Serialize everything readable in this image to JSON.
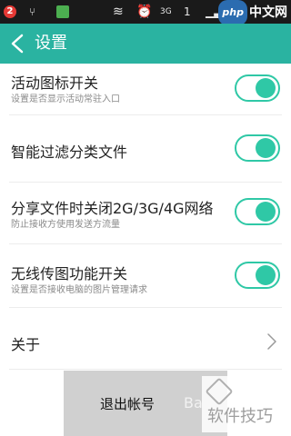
{
  "status_bar": {
    "notification_count": "2",
    "usb_icon": "usb-icon",
    "wifi_icon": "wifi-icon",
    "alarm_icon": "alarm-icon",
    "network_type": "3G",
    "sim_label": "1",
    "watermark": "php中文网"
  },
  "header": {
    "title": "设置",
    "back_icon": "chevron-left-icon",
    "background": "#2ab3a1"
  },
  "settings": [
    {
      "title": "活动图标开关",
      "subtitle": "设置是否显示活动常驻入口",
      "toggle_on": true
    },
    {
      "title": "智能过滤分类文件",
      "subtitle": "",
      "toggle_on": true
    },
    {
      "title": "分享文件时关闭2G/3G/4G网络",
      "subtitle": "防止接收方使用发送方流量",
      "toggle_on": true
    },
    {
      "title": "无线传图功能开关",
      "subtitle": "设置是否接收电脑的图片管理请求",
      "toggle_on": true
    }
  ],
  "about": {
    "label": "关于",
    "icon": "chevron-right-icon"
  },
  "logout": {
    "label": "退出帐号",
    "overlay_text": "Ba"
  },
  "watermark_bottom": {
    "text": "软件技巧"
  },
  "colors": {
    "accent": "#2fc8a6",
    "header": "#2ab3a1",
    "status_bar": "#1a1a1a",
    "logout_bg": "#d0d0d0"
  }
}
